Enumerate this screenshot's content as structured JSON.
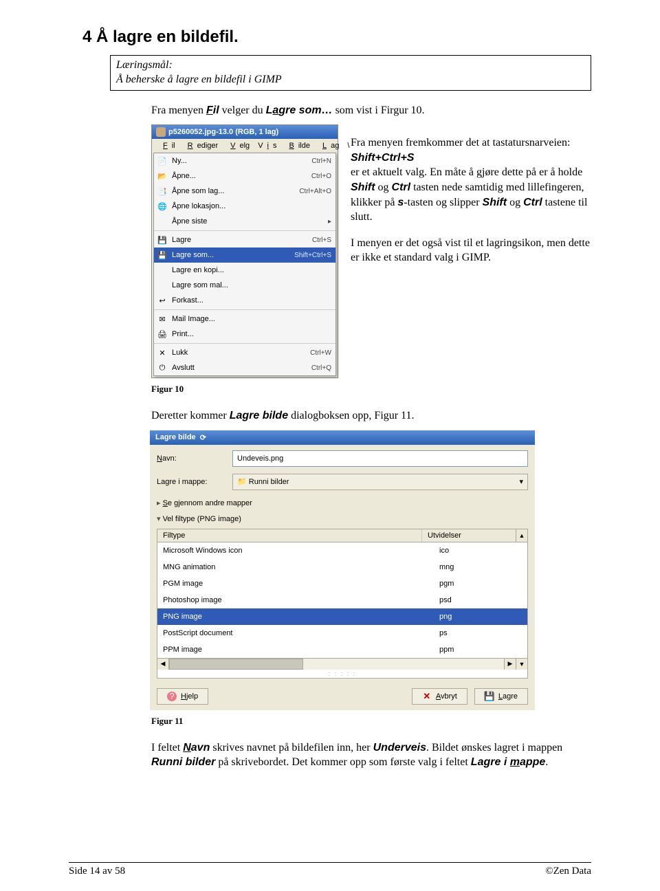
{
  "section": {
    "title": "4  Å lagre en bildefil."
  },
  "goals": {
    "heading": "Læringsmål:",
    "text": "Å beherske å lagre en bildefil i GIMP"
  },
  "intro_a": "Fra menyen ",
  "intro_fil": "Fil",
  "intro_b": " velger du ",
  "intro_lagre": "Lagre som…",
  "intro_c": " som vist i Firgur 10.",
  "menu_shot": {
    "title": "p5260052.jpg-13.0 (RGB, 1 lag)",
    "menubar": [
      "Fil",
      "Rediger",
      "Velg",
      "Vis",
      "Bilde",
      "Lag",
      "\\"
    ],
    "items": [
      {
        "icon": "📄",
        "label": "Ny...",
        "shortcut": "Ctrl+N"
      },
      {
        "icon": "📂",
        "label": "Åpne...",
        "shortcut": "Ctrl+O"
      },
      {
        "icon": "📑",
        "label": "Åpne som lag...",
        "shortcut": "Ctrl+Alt+O"
      },
      {
        "icon": "🌐",
        "label": "Åpne lokasjon...",
        "shortcut": ""
      },
      {
        "icon": "",
        "label": "Åpne siste",
        "shortcut": "▸"
      },
      {
        "sep": true
      },
      {
        "icon": "💾",
        "label": "Lagre",
        "shortcut": "Ctrl+S"
      },
      {
        "icon": "💾",
        "label": "Lagre som...",
        "shortcut": "Shift+Ctrl+S",
        "selected": true
      },
      {
        "icon": "",
        "label": "Lagre en kopi...",
        "shortcut": ""
      },
      {
        "icon": "",
        "label": "Lagre som mal...",
        "shortcut": ""
      },
      {
        "icon": "↩",
        "label": "Forkast...",
        "shortcut": ""
      },
      {
        "sep": true
      },
      {
        "icon": "✉",
        "label": "Mail Image...",
        "shortcut": ""
      },
      {
        "icon": "🖨",
        "label": "Print...",
        "shortcut": ""
      },
      {
        "sep": true
      },
      {
        "icon": "✕",
        "label": "Lukk",
        "shortcut": "Ctrl+W"
      },
      {
        "icon": "⏻",
        "label": "Avslutt",
        "shortcut": "Ctrl+Q"
      }
    ]
  },
  "side_text": {
    "p1a": "Fra menyen fremkommer det at tastatursnarveien:",
    "p1b": "Shift+Ctrl+S",
    "p1c": "er et aktuelt valg. En måte å gjøre dette på er å holde ",
    "p1d": "Shift",
    "p1e": " og ",
    "p1f": "Ctrl",
    "p1g": " tasten nede samtidig med lillefingeren, klikker på ",
    "p1h": "s",
    "p1i": "-tasten og slipper ",
    "p1j": "Shift",
    "p1k": " og ",
    "p1l": "Ctrl",
    "p1m": " tastene til slutt.",
    "p2": "I menyen er det også vist til et lagringsikon, men dette er ikke et standard valg i GIMP."
  },
  "fig10": "Figur 10",
  "mid_a": "Deretter kommer ",
  "mid_b": "Lagre bilde",
  "mid_c": " dialogboksen opp, Figur 11.",
  "dialog": {
    "title": "Lagre bilde",
    "name_label": "Navn:",
    "name_value": "Undeveis.png",
    "folder_label": "Lagre i mappe:",
    "folder_value": "Runni bilder",
    "browse": "Se gjennom andre mapper",
    "filetype_exp": "Vel filtype (PNG image)",
    "col_type": "Filtype",
    "col_ext": "Utvidelser",
    "rows": [
      {
        "type": "Microsoft Windows icon",
        "ext": "ico"
      },
      {
        "type": "MNG animation",
        "ext": "mng"
      },
      {
        "type": "PGM image",
        "ext": "pgm"
      },
      {
        "type": "Photoshop image",
        "ext": "psd"
      },
      {
        "type": "PNG image",
        "ext": "png",
        "selected": true
      },
      {
        "type": "PostScript document",
        "ext": "ps"
      },
      {
        "type": "PPM image",
        "ext": "ppm"
      }
    ],
    "buttons": {
      "help": "Hjelp",
      "cancel": "Avbryt",
      "save": "Lagre"
    }
  },
  "fig11": "Figur 11",
  "after_a": "I feltet ",
  "after_navn": "Navn",
  "after_b": " skrives navnet på bildefilen inn, her ",
  "after_under": "Underveis",
  "after_c": ". Bildet ønskes lagret i mappen ",
  "after_runni": "Runni bilder",
  "after_d": " på skrivebordet. Det kommer opp som første valg i feltet ",
  "after_lim": "Lagre i mappe",
  "after_e": ".",
  "footer": {
    "left": "Side 14 av 58",
    "right": "©Zen Data"
  }
}
